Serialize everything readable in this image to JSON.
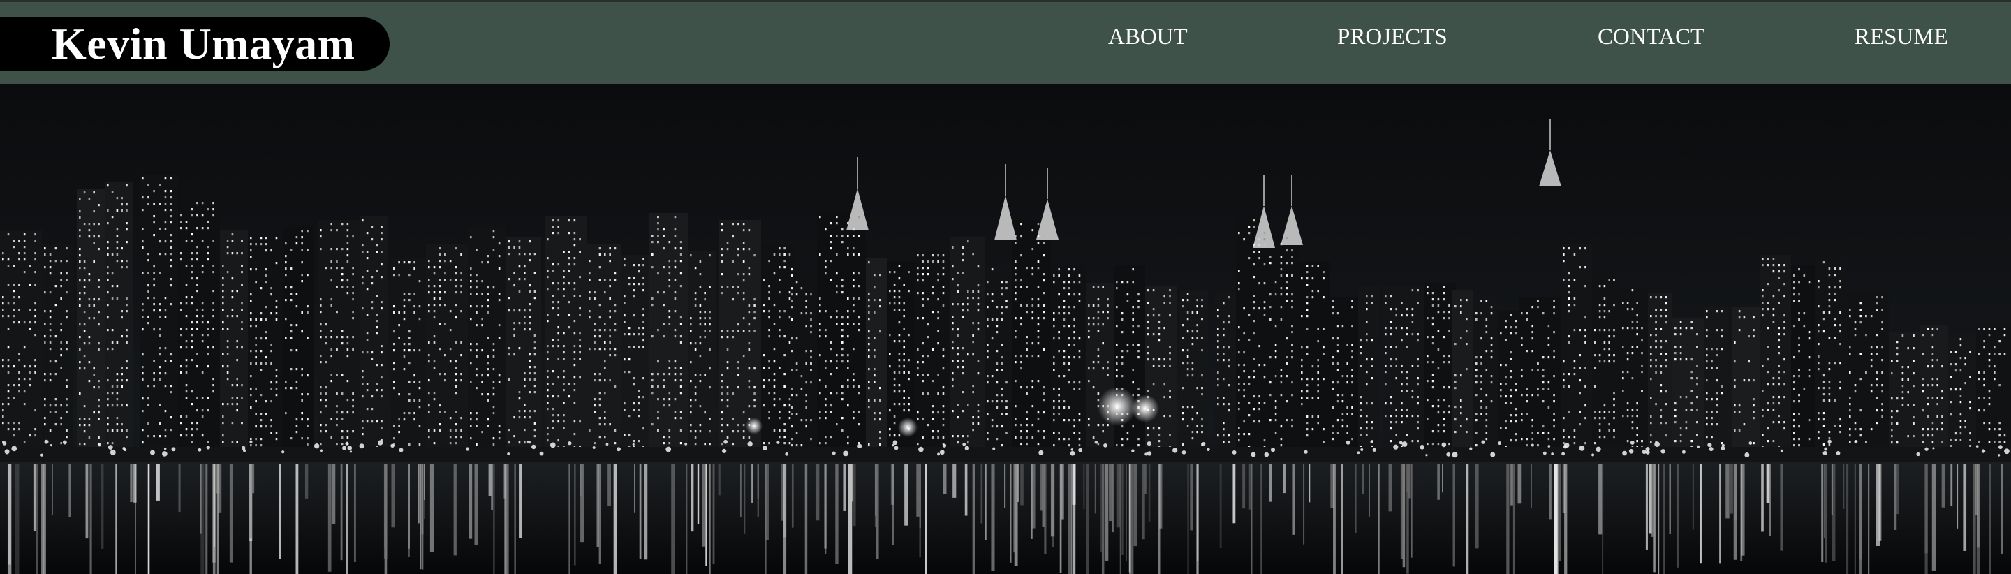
{
  "site": {
    "owner_name": "Kevin Umayam"
  },
  "nav": {
    "items": [
      {
        "label": "ABOUT"
      },
      {
        "label": "PROJECTS"
      },
      {
        "label": "CONTACT"
      },
      {
        "label": "RESUME"
      }
    ]
  },
  "hero": {
    "image_subject": "night-city-skyline-reflection"
  },
  "colors": {
    "navbar_bg": "#3e5249",
    "brand_pill_bg": "#000000",
    "nav_text": "#ffffff",
    "hero_sky": "#0d0f11"
  }
}
